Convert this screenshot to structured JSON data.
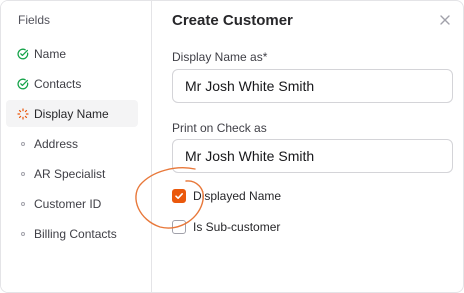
{
  "sidebar": {
    "title": "Fields",
    "items": [
      {
        "label": "Name",
        "status": "done",
        "icon": "check-circle-icon"
      },
      {
        "label": "Contacts",
        "status": "done",
        "icon": "check-circle-icon"
      },
      {
        "label": "Display Name",
        "status": "in-progress",
        "icon": "spinner-icon"
      },
      {
        "label": "Address",
        "status": "pending",
        "icon": "dot-icon"
      },
      {
        "label": "AR Specialist",
        "status": "pending",
        "icon": "dot-icon"
      },
      {
        "label": "Customer ID",
        "status": "pending",
        "icon": "dot-icon"
      },
      {
        "label": "Billing Contacts",
        "status": "pending",
        "icon": "dot-icon"
      }
    ]
  },
  "dialog": {
    "title": "Create Customer",
    "close_icon": "close-icon",
    "display_name": {
      "label": "Display Name as*",
      "value": "Mr Josh White Smith"
    },
    "print_on_check": {
      "label": "Print on Check as",
      "value": "Mr Josh White Smith"
    },
    "displayed_name": {
      "label": "Displayed Name",
      "checked": true
    },
    "sub_customer": {
      "label": "Is Sub-customer",
      "checked": false
    }
  },
  "colors": {
    "accent": "#ea580c",
    "done": "#16a34a",
    "annotation": "#e8783a",
    "border": "#e4e4e7"
  }
}
